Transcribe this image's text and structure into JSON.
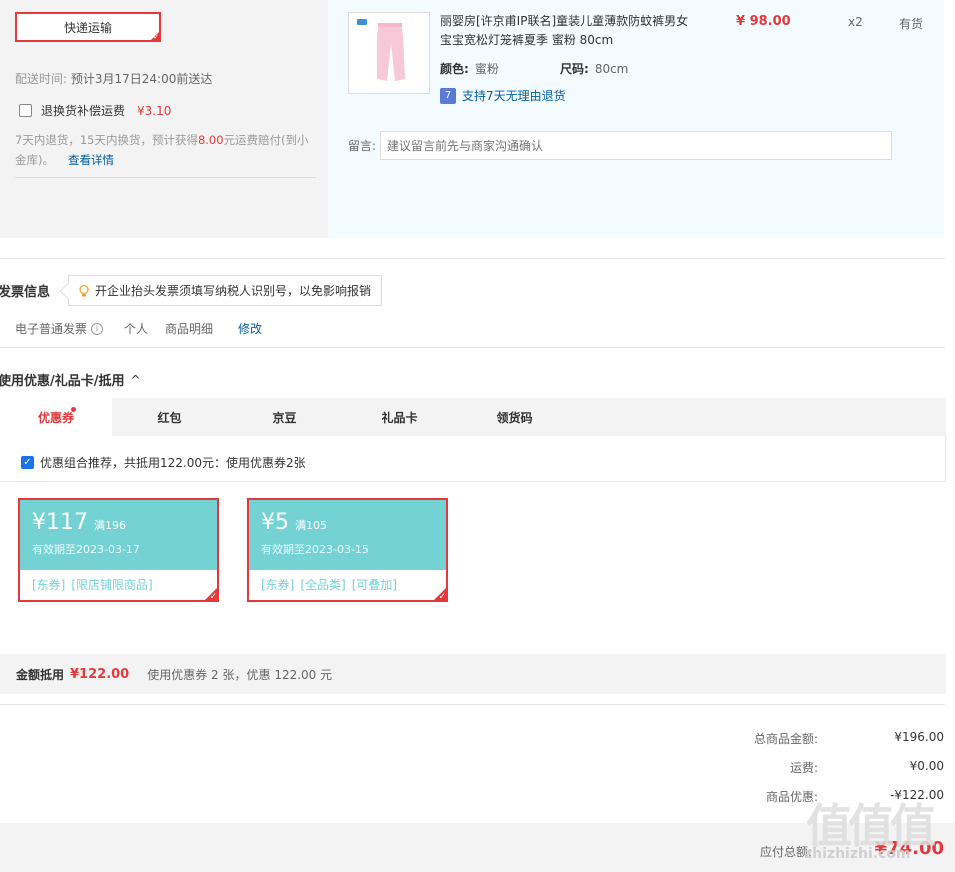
{
  "shipping": {
    "method_label": "快递运输",
    "delivery_label": "配送时间:",
    "delivery_value": "预计3月17日24:00前送达",
    "insurance_label": "退换货补偿运费",
    "insurance_price": "¥3.10",
    "insurance_desc_1": "7天内退货，15天内换货，预计获得",
    "insurance_amount": "8.00",
    "insurance_desc_2": "元运费赔付(到小金库)。",
    "insurance_link": "查看详情"
  },
  "product": {
    "title": "丽婴房[许京甫IP联名]童装儿童薄款防蚊裤男女宝宝宽松灯笼裤夏季 蜜粉 80cm",
    "price": "¥ 98.00",
    "qty": "x2",
    "stock": "有货",
    "color_label": "颜色:",
    "color_value": "蜜粉",
    "size_label": "尺码:",
    "size_value": "80cm",
    "return_icon": "7",
    "return_text": "支持7天无理由退货",
    "message_label": "留言:",
    "message_placeholder": "建议留言前先与商家沟通确认"
  },
  "invoice": {
    "title": "发票信息",
    "tip": "开企业抬头发票须填写纳税人识别号，以免影响报销",
    "type": "电子普通发票",
    "info_glyph": "i",
    "header": "个人",
    "content": "商品明细",
    "modify": "修改"
  },
  "coupons": {
    "title": "使用优惠/礼品卡/抵用",
    "chevron_glyph": "^",
    "tabs": [
      "优惠券",
      "红包",
      "京豆",
      "礼品卡",
      "领货码"
    ],
    "combo_text": "优惠组合推荐，共抵用122.00元：使用优惠券2张",
    "items": [
      {
        "amount": "¥117",
        "condition": "满196",
        "expiry": "有效期至2023-03-17",
        "tags": [
          "[东券]",
          "[限店铺限商品]"
        ]
      },
      {
        "amount": "¥5",
        "condition": "满105",
        "expiry": "有效期至2023-03-15",
        "tags": [
          "[东券]",
          "[全品类]",
          "[可叠加]"
        ]
      }
    ],
    "summary_label": "金额抵用",
    "summary_amount": "¥122.00",
    "summary_text": "使用优惠券 2 张，优惠 122.00 元"
  },
  "totals": {
    "goods_label": "总商品金额:",
    "goods_value": "¥196.00",
    "freight_label": "运费:",
    "freight_value": "¥0.00",
    "discount_label": "商品优惠:",
    "discount_value": "-¥122.00",
    "payable_label": "应付总额:",
    "payable_value": "¥74.00"
  },
  "watermark": {
    "text": "值值值",
    "url": "zhizhizhi.com"
  },
  "colors": {
    "accent": "#e4393c",
    "link": "#005ea7",
    "coupon": "#74d2d5"
  }
}
